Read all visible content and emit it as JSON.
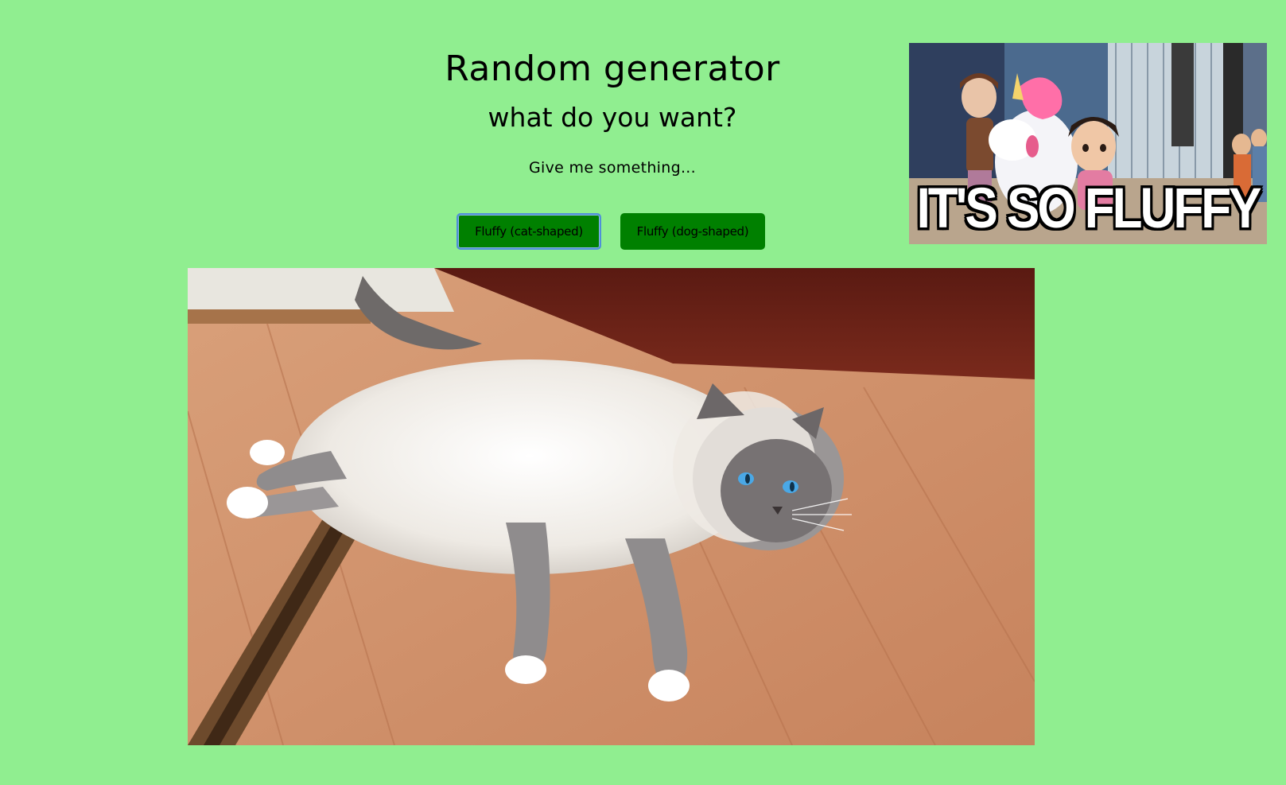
{
  "header": {
    "title": "Random generator",
    "subtitle": "what do you want?",
    "prompt": "Give me something..."
  },
  "buttons": {
    "cat_label": "Fluffy (cat-shaped)",
    "dog_label": "Fluffy (dog-shaped)"
  },
  "meme": {
    "caption": "IT'S SO FLUFFY"
  },
  "colors": {
    "background": "#90ee90",
    "button": "#008000",
    "focus_ring": "#4f8fd8"
  }
}
